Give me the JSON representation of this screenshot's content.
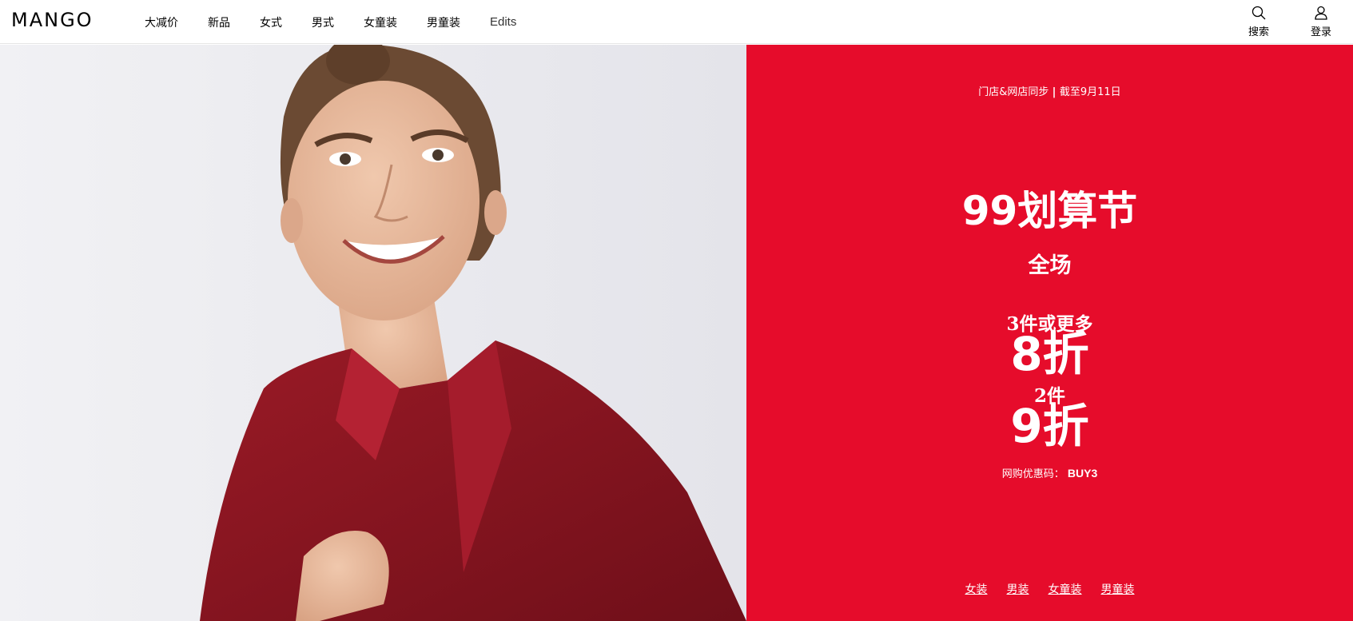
{
  "header": {
    "logo": "MANGO",
    "nav": [
      "大减价",
      "新品",
      "女式",
      "男式",
      "女童装",
      "男童装",
      "Edits"
    ],
    "search_label": "搜索",
    "login_label": "登录"
  },
  "hero": {
    "image": "woman-in-red-blouse-smiling"
  },
  "promo": {
    "background_color": "#e60c2b",
    "eyebrow_prefix": "门店&网店同步",
    "eyebrow_suffix": "截至9月11日",
    "title": "99划算节",
    "subtitle": "全场",
    "tier1_label": "3件或更多",
    "tier1_value": "8折",
    "tier2_label": "2件",
    "tier2_value": "9折",
    "code_label": "网购优惠码：",
    "code_value": "BUY3",
    "links": [
      "女装",
      "男装",
      "女童装",
      "男童装"
    ]
  }
}
